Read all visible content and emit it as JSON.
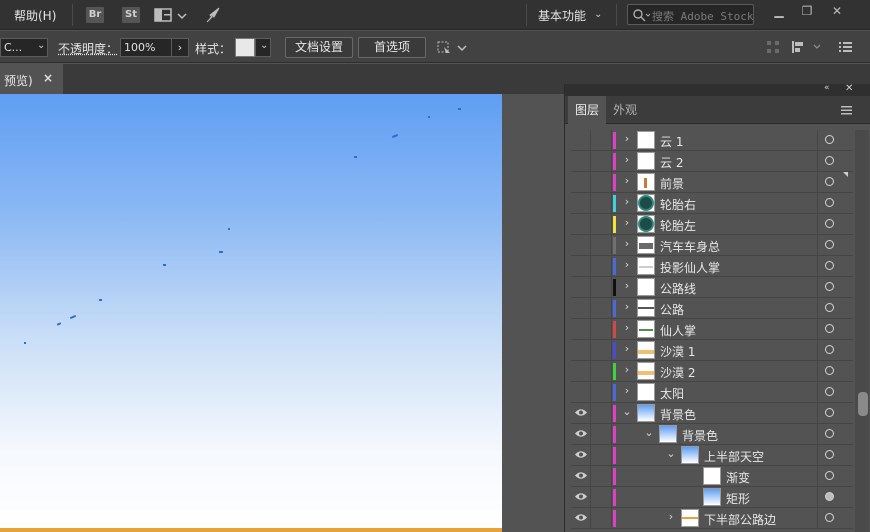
{
  "menubar": {
    "help_label": "帮助(H)",
    "bridge_badge": "Br",
    "stock_badge": "St",
    "workspace_label": "基本功能",
    "search_placeholder": "搜索 Adobe Stock",
    "icons": [
      "arrange-documents-icon",
      "rocket-icon",
      "search-icon",
      "minimize-icon",
      "restore-icon",
      "close-icon"
    ]
  },
  "controlbar": {
    "style_value": "C...",
    "opacity_label": "不透明度：",
    "opacity_value": "100%",
    "style_label": "样式：",
    "doc_settings_label": "文档设置",
    "preferences_label": "首选项"
  },
  "document_tab": {
    "title": "预览)",
    "close_glyph": "×"
  },
  "layers_panel": {
    "tabs": [
      {
        "label": "图层",
        "active": true
      },
      {
        "label": "外观",
        "active": false
      }
    ],
    "layers": [
      {
        "name": "云 1",
        "color": "#e040c8",
        "visible": false,
        "expanded": false,
        "depth": 0,
        "thumb": "blank"
      },
      {
        "name": "云 2",
        "color": "#e040c8",
        "visible": false,
        "expanded": false,
        "depth": 0,
        "thumb": "blank"
      },
      {
        "name": "前景",
        "color": "#e040c8",
        "visible": false,
        "expanded": false,
        "depth": 0,
        "thumb": "foreground"
      },
      {
        "name": "轮胎右",
        "color": "#40d0e0",
        "visible": false,
        "expanded": false,
        "depth": 0,
        "thumb": "tire"
      },
      {
        "name": "轮胎左",
        "color": "#f0e040",
        "visible": false,
        "expanded": false,
        "depth": 0,
        "thumb": "tire"
      },
      {
        "name": "汽车车身总",
        "color": "#707070",
        "visible": false,
        "expanded": false,
        "depth": 0,
        "thumb": "car"
      },
      {
        "name": "投影仙人掌",
        "color": "#4a6ad8",
        "visible": false,
        "expanded": false,
        "depth": 0,
        "thumb": "shadow"
      },
      {
        "name": "公路线",
        "color": "#101010",
        "visible": false,
        "expanded": false,
        "depth": 0,
        "thumb": "blank"
      },
      {
        "name": "公路",
        "color": "#4a6ad8",
        "visible": false,
        "expanded": false,
        "depth": 0,
        "thumb": "road"
      },
      {
        "name": "仙人掌",
        "color": "#d04848",
        "visible": false,
        "expanded": false,
        "depth": 0,
        "thumb": "cactus"
      },
      {
        "name": "沙漠 1",
        "color": "#4a4ad8",
        "visible": false,
        "expanded": false,
        "depth": 0,
        "thumb": "desert"
      },
      {
        "name": "沙漠 2",
        "color": "#40d040",
        "visible": false,
        "expanded": false,
        "depth": 0,
        "thumb": "desert"
      },
      {
        "name": "太阳",
        "color": "#4a6ad8",
        "visible": false,
        "expanded": false,
        "depth": 0,
        "thumb": "blank"
      },
      {
        "name": "背景色",
        "color": "#e040c8",
        "visible": true,
        "expanded": true,
        "depth": 0,
        "thumb": "sky"
      },
      {
        "name": "背景色",
        "color": "#e040c8",
        "visible": true,
        "expanded": true,
        "depth": 1,
        "thumb": "sky"
      },
      {
        "name": "上半部天空",
        "color": "#e040c8",
        "visible": true,
        "expanded": true,
        "depth": 2,
        "thumb": "sky"
      },
      {
        "name": "渐变",
        "color": "#e040c8",
        "visible": true,
        "expanded": null,
        "depth": 3,
        "thumb": "blank"
      },
      {
        "name": "矩形",
        "color": "#e040c8",
        "visible": true,
        "expanded": null,
        "depth": 3,
        "thumb": "sky"
      },
      {
        "name": "下半部公路边",
        "color": "#e040c8",
        "visible": true,
        "expanded": false,
        "depth": 2,
        "thumb": "roadside"
      }
    ]
  }
}
